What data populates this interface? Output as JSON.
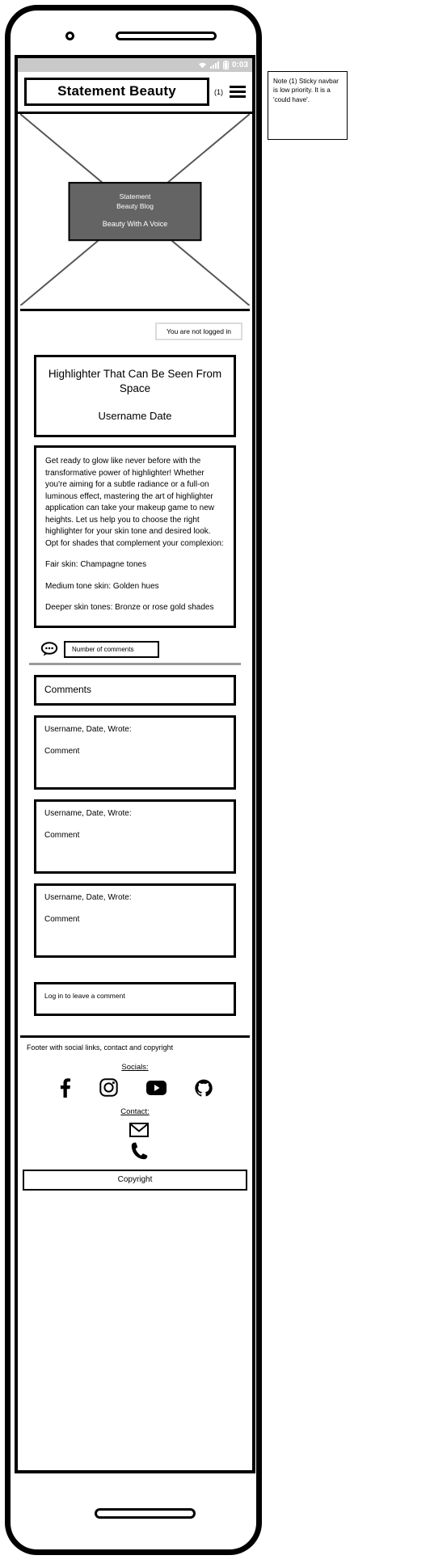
{
  "status_bar": {
    "time": "0:03",
    "wifi_icon": "wifi-icon",
    "signal_icon": "signal-icon",
    "battery_icon": "battery-icon"
  },
  "navbar": {
    "brand": "Statement Beauty",
    "note_ref": "(1)",
    "menu_icon": "hamburger-menu-icon"
  },
  "hero": {
    "title_line1": "Statement",
    "title_line2": "Beauty Blog",
    "tagline": "Beauty With A Voice",
    "placeholder_icon": "image-placeholder-x"
  },
  "login_status": "You are not logged in",
  "article": {
    "title": "Highlighter That Can Be Seen From Space",
    "meta": "Username Date",
    "paragraphs": [
      "Get ready to glow like never before with the transformative power of highlighter! Whether you're aiming for a subtle radiance or a full-on luminous effect, mastering the art of highlighter application can take your makeup game to new heights. Let us help you to choose the right highlighter for your skin tone and desired look. Opt for shades that complement your complexion:",
      "Fair skin: Champagne tones",
      "Medium tone skin: Golden hues",
      "Deeper skin tones: Bronze or rose gold shades"
    ]
  },
  "comments_section": {
    "bubble_icon": "speech-bubble-icon",
    "count_label": "Number of comments",
    "header": "Comments",
    "items": [
      {
        "author": "Username, Date, Wrote:",
        "text": "Comment"
      },
      {
        "author": "Username, Date, Wrote:",
        "text": "Comment"
      },
      {
        "author": "Username, Date, Wrote:",
        "text": "Comment"
      }
    ],
    "leave_comment": "Log in to leave a comment"
  },
  "footer": {
    "caption": "Footer with social links, contact and copyright",
    "socials_label": "Socials:",
    "socials": [
      {
        "name": "facebook-icon"
      },
      {
        "name": "instagram-icon"
      },
      {
        "name": "youtube-icon"
      },
      {
        "name": "github-icon"
      }
    ],
    "contact_label": "Contact:",
    "contacts": [
      {
        "name": "email-icon"
      },
      {
        "name": "phone-icon"
      }
    ],
    "copyright": "Copyright"
  },
  "note": "Note (1) Sticky navbar is low priority. It is a 'could have'."
}
